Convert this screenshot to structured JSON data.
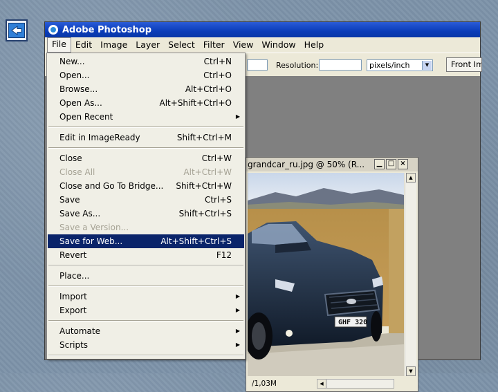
{
  "window": {
    "title": "Adobe Photoshop"
  },
  "menubar": {
    "items": [
      {
        "label": "File",
        "active": true
      },
      {
        "label": "Edit"
      },
      {
        "label": "Image"
      },
      {
        "label": "Layer"
      },
      {
        "label": "Select"
      },
      {
        "label": "Filter"
      },
      {
        "label": "View"
      },
      {
        "label": "Window"
      },
      {
        "label": "Help"
      }
    ]
  },
  "options": {
    "resolution_label": "Resolution:",
    "resolution_unit": "pixels/inch",
    "front_image_label": "Front Image"
  },
  "document": {
    "title": "grandcar_ru.jpg @ 50% (R...",
    "doc_size": "/1,03M",
    "plate": "GHF 320"
  },
  "file_menu": {
    "items": [
      {
        "label": "New...",
        "shortcut": "Ctrl+N"
      },
      {
        "label": "Open...",
        "shortcut": "Ctrl+O"
      },
      {
        "label": "Browse...",
        "shortcut": "Alt+Ctrl+O"
      },
      {
        "label": "Open As...",
        "shortcut": "Alt+Shift+Ctrl+O"
      },
      {
        "label": "Open Recent",
        "shortcut": "",
        "submenu": true
      },
      {
        "separator": true
      },
      {
        "label": "Edit in ImageReady",
        "shortcut": "Shift+Ctrl+M"
      },
      {
        "separator": true
      },
      {
        "label": "Close",
        "shortcut": "Ctrl+W"
      },
      {
        "label": "Close All",
        "shortcut": "Alt+Ctrl+W",
        "disabled": true
      },
      {
        "label": "Close and Go To Bridge...",
        "shortcut": "Shift+Ctrl+W"
      },
      {
        "label": "Save",
        "shortcut": "Ctrl+S"
      },
      {
        "label": "Save As...",
        "shortcut": "Shift+Ctrl+S"
      },
      {
        "label": "Save a Version...",
        "shortcut": "",
        "disabled": true
      },
      {
        "label": "Save for Web...",
        "shortcut": "Alt+Shift+Ctrl+S",
        "highlighted": true
      },
      {
        "label": "Revert",
        "shortcut": "F12"
      },
      {
        "separator": true
      },
      {
        "label": "Place...",
        "shortcut": ""
      },
      {
        "separator": true
      },
      {
        "label": "Import",
        "shortcut": "",
        "submenu": true
      },
      {
        "label": "Export",
        "shortcut": "",
        "submenu": true
      },
      {
        "separator": true
      },
      {
        "label": "Automate",
        "shortcut": "",
        "submenu": true
      },
      {
        "label": "Scripts",
        "shortcut": "",
        "submenu": true
      },
      {
        "separator": true
      }
    ]
  },
  "colors": {
    "titlebar": "#0a3cb8",
    "highlight": "#0a246a",
    "workspace": "#808080",
    "slide_bg": "#7d93a9"
  },
  "icons": {
    "back": "back-arrow-icon",
    "app": "photoshop-app-icon",
    "submenu": "submenu-arrow-icon"
  }
}
